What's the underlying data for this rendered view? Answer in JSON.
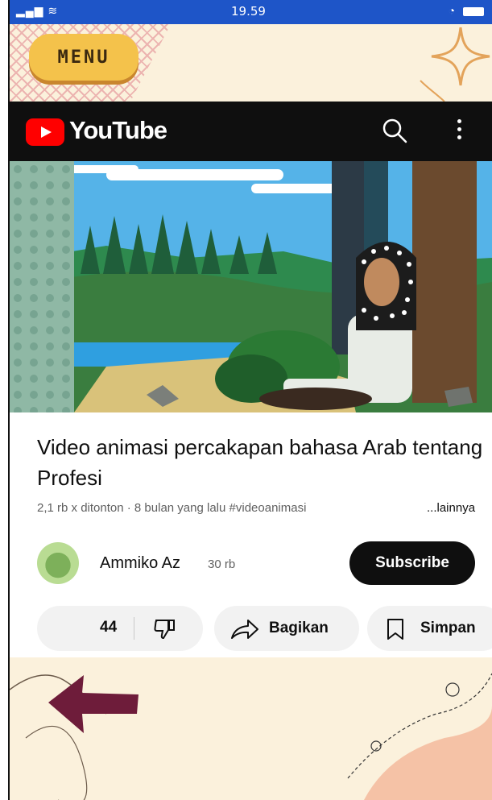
{
  "status_bar": {
    "signal": "⇅il",
    "time": "19.59"
  },
  "app": {
    "menu_label": "MENU"
  },
  "youtube": {
    "wordmark": "YouTube"
  },
  "video": {
    "title": "Video animasi percakapan bahasa Arab tentang Profesi",
    "views": "2,1 rb x ditonton",
    "separator": "·",
    "age": "8 bulan yang lalu",
    "hashtag": "#videoanimasi",
    "more_label": "...lainnya"
  },
  "channel": {
    "name": "Ammiko Az",
    "subscribers": "30 rb",
    "subscribe_label": "Subscribe"
  },
  "actions": {
    "like_count": "44",
    "share_label": "Bagikan",
    "save_label": "Simpan"
  },
  "colors": {
    "status_bar": "#1e55c8",
    "cream": "#fbf1dc",
    "menu_yellow": "#f4c24b",
    "youtube_red": "#ff0000",
    "back_arrow": "#6e1c3a"
  }
}
